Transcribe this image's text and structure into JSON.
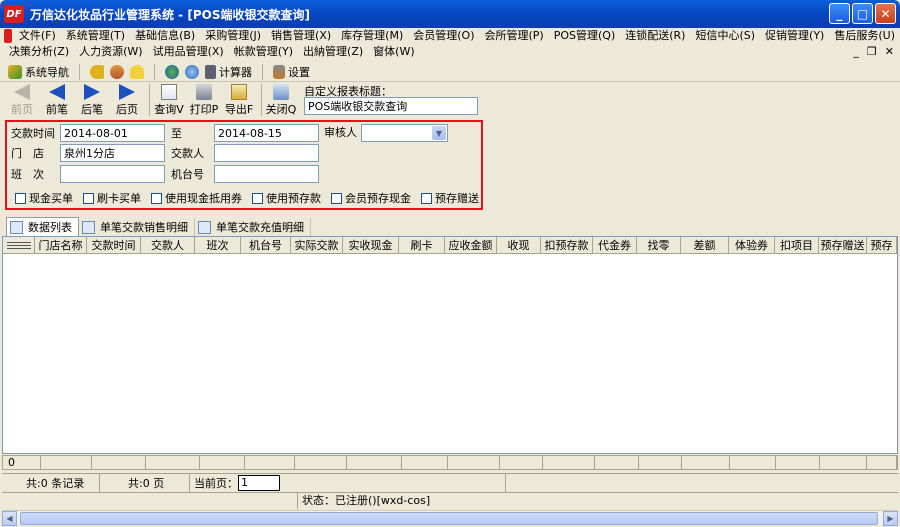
{
  "window": {
    "logo_text": "DF",
    "title": "万信达化妆品行业管理系统 - [POS端收银交款查询]",
    "controls": {
      "minimize": "_",
      "maximize": "□",
      "close": "✕"
    }
  },
  "menu": {
    "row1": [
      "文件(F)",
      "系统管理(T)",
      "基础信息(B)",
      "采购管理(J)",
      "销售管理(X)",
      "库存管理(M)",
      "会员管理(O)",
      "会所管理(P)",
      "POS管理(Q)",
      "连锁配送(R)",
      "短信中心(S)",
      "促销管理(Y)",
      "售后服务(U)"
    ],
    "row2": [
      "决策分析(Z)",
      "人力资源(W)",
      "试用品管理(X)",
      "帐款管理(Y)",
      "出納管理(Z)",
      "窗体(W)"
    ],
    "mdi_controls": {
      "minimize": "_",
      "restore": "❐",
      "close": "✕"
    }
  },
  "toolbar1": {
    "nav_label": "系统导航",
    "calculator_label": "计算器",
    "settings_label": "设置"
  },
  "toolbar2": {
    "buttons": [
      {
        "label": "前页",
        "enabled": false,
        "icon": "prev-page-icon"
      },
      {
        "label": "前笔",
        "enabled": true,
        "icon": "prev-record-icon"
      },
      {
        "label": "后笔",
        "enabled": true,
        "icon": "next-record-icon"
      },
      {
        "label": "后页",
        "enabled": true,
        "icon": "next-page-icon"
      },
      {
        "label": "查询V",
        "enabled": true,
        "icon": "query-icon"
      },
      {
        "label": "打印P",
        "enabled": true,
        "icon": "print-icon"
      },
      {
        "label": "导出F",
        "enabled": true,
        "icon": "export-icon"
      },
      {
        "label": "关闭Q",
        "enabled": true,
        "icon": "close-doc-icon"
      }
    ],
    "report_title_label": "自定义报表标题：",
    "report_title_value": "POS端收银交款查询"
  },
  "filter": {
    "date_label": "交款时间",
    "date_from": "2014-08-01",
    "to_label": "至",
    "date_to": "2014-08-15",
    "auditor_label": "审核人",
    "auditor_value": "",
    "store_label": "门　店",
    "store_value": "泉州1分店",
    "payer_label": "交款人",
    "payer_value": "",
    "shift_label": "班　次",
    "shift_value": "",
    "terminal_label": "机台号",
    "terminal_value": "",
    "checkboxes": [
      "现金买单",
      "刷卡买单",
      "使用现金抵用券",
      "使用预存款",
      "会员预存现金",
      "预存赠送"
    ]
  },
  "tabs": [
    "数据列表",
    "单笔交款销售明细",
    "单笔交款充值明细"
  ],
  "grid": {
    "columns": [
      "门店名称",
      "交款时间",
      "交款人",
      "班次",
      "机台号",
      "实际交款",
      "实收现金",
      "刷卡",
      "应收金额",
      "收现",
      "扣预存款",
      "代金券",
      "找零",
      "差额",
      "体验券",
      "扣项目",
      "预存赠送",
      "预存"
    ],
    "footer_first": "0"
  },
  "pager": {
    "total_records": "共:0 条记录",
    "total_pages": "共:0 页",
    "current_label": "当前页：",
    "current_value": "1"
  },
  "status": {
    "text": "状态：已注册()[wxd-cos]"
  }
}
